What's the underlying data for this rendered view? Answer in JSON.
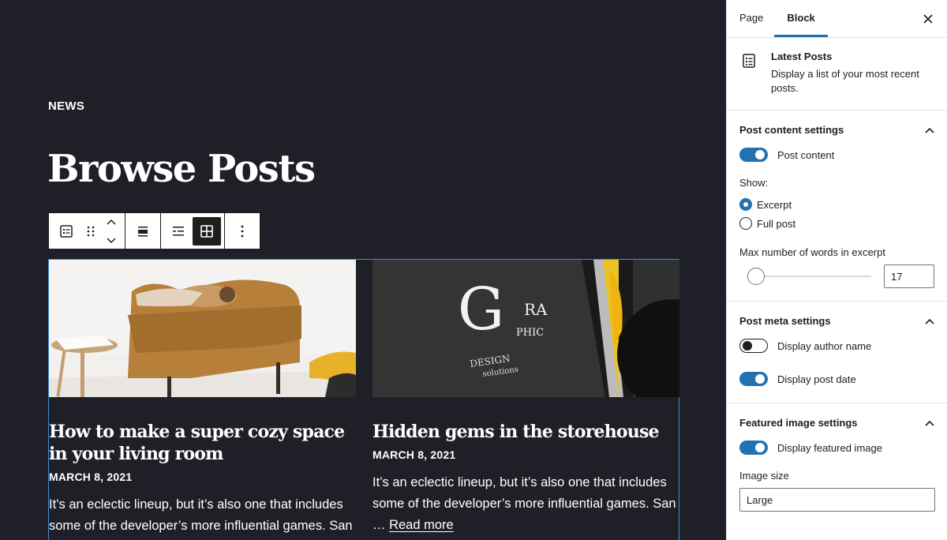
{
  "canvas": {
    "section_label": "NEWS",
    "heading": "Browse Posts",
    "posts": [
      {
        "title": "How to make a super cozy space in your living room",
        "date": "MARCH 8, 2021",
        "excerpt": "It’s an eclectic lineup, but it’s also one that includes some of the developer’s more influential games. San"
      },
      {
        "title": "Hidden gems in the storehouse",
        "date": "MARCH 8, 2021",
        "excerpt": "It’s an eclectic lineup, but it’s also one that includes some of the developer’s more influential games. San …",
        "read_more": "Read more"
      }
    ],
    "image_text": {
      "g": "G",
      "ra": "RA",
      "phic": "PHIC",
      "design": "DESIGN",
      "solutions": "solutions"
    }
  },
  "toolbar": {
    "icons": [
      "latest-posts-icon",
      "drag-handle-icon",
      "move-up-icon",
      "move-down-icon",
      "align-icon",
      "list-view-icon",
      "grid-view-icon",
      "more-options-icon"
    ]
  },
  "sidebar": {
    "tabs": [
      {
        "label": "Page"
      },
      {
        "label": "Block"
      }
    ],
    "block": {
      "title": "Latest Posts",
      "description": "Display a list of your most recent posts."
    },
    "post_content_settings": {
      "title": "Post content settings",
      "toggle_label": "Post content",
      "show_label": "Show:",
      "radio_excerpt": "Excerpt",
      "radio_full": "Full post",
      "words_label": "Max number of words in excerpt",
      "words_value": "17"
    },
    "post_meta_settings": {
      "title": "Post meta settings",
      "author_label": "Display author name",
      "date_label": "Display post date"
    },
    "featured_image_settings": {
      "title": "Featured image settings",
      "display_label": "Display featured image",
      "size_label": "Image size",
      "size_value": "Large"
    }
  },
  "colors": {
    "canvas_bg": "#1f2027",
    "accent": "#2271b1",
    "selection_border": "#3a8fd6"
  }
}
